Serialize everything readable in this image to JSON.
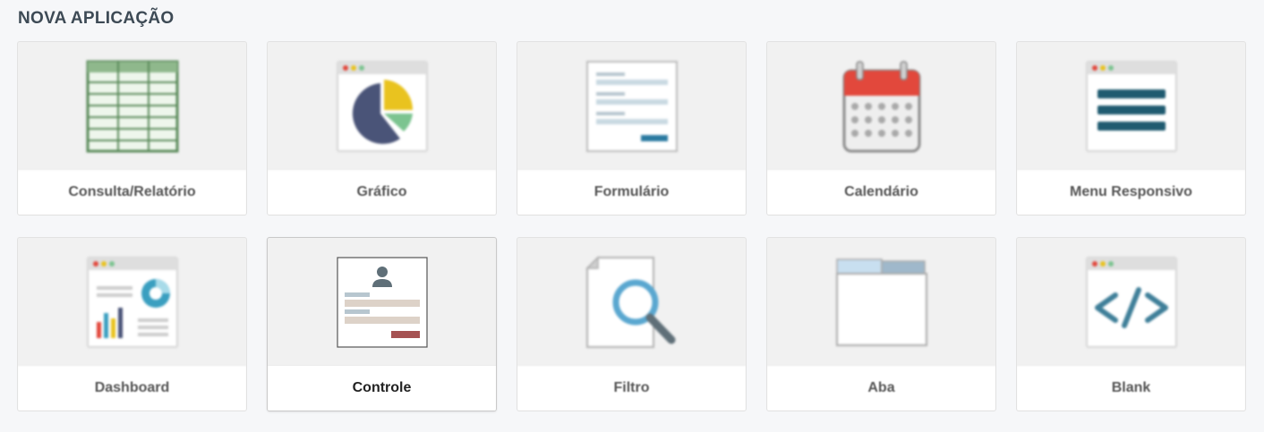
{
  "section": {
    "title": "NOVA APLICAÇÃO"
  },
  "cards": [
    {
      "label": "Consulta/Relatório",
      "icon": "table-icon"
    },
    {
      "label": "Gráfico",
      "icon": "pie-chart-icon"
    },
    {
      "label": "Formulário",
      "icon": "form-icon"
    },
    {
      "label": "Calendário",
      "icon": "calendar-icon"
    },
    {
      "label": "Menu Responsivo",
      "icon": "menu-icon"
    },
    {
      "label": "Dashboard",
      "icon": "dashboard-icon"
    },
    {
      "label": "Controle",
      "icon": "control-user-icon"
    },
    {
      "label": "Filtro",
      "icon": "search-icon"
    },
    {
      "label": "Aba",
      "icon": "tabs-icon"
    },
    {
      "label": "Blank",
      "icon": "code-icon"
    }
  ],
  "colors": {
    "title": "#3d4a55",
    "table_green": "#5a8a5a",
    "pie_navy": "#4a5478",
    "pie_yellow": "#e9c31f",
    "pie_green": "#7cc490",
    "calendar_red": "#e2483c",
    "menu_teal": "#1f5b70",
    "search_blue": "#5aa7d0",
    "control_button": "#a55252"
  }
}
